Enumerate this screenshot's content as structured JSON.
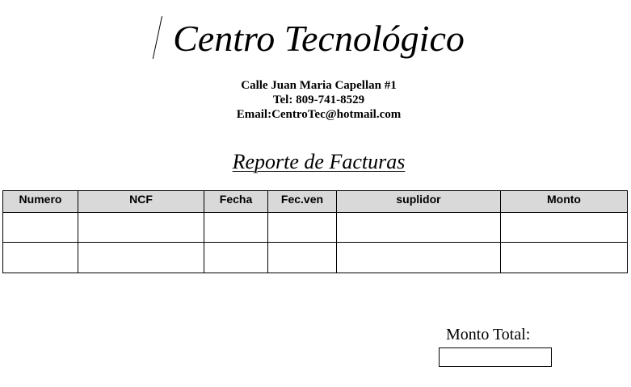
{
  "header": {
    "company_name": "Centro Tecnológico",
    "address": "Calle Juan Maria Capellan #1",
    "phone": "Tel: 809-741-8529",
    "email": "Email:CentroTec@hotmail.com"
  },
  "report": {
    "title": "Reporte de Facturas"
  },
  "table": {
    "columns": [
      "Numero",
      "NCF",
      "Fecha",
      "Fec.ven",
      "suplidor",
      "Monto"
    ],
    "rows": [
      [
        "",
        "",
        "",
        "",
        "",
        ""
      ],
      [
        "",
        "",
        "",
        "",
        "",
        ""
      ]
    ]
  },
  "summary": {
    "total_label": "Monto Total:",
    "total_value": ""
  }
}
